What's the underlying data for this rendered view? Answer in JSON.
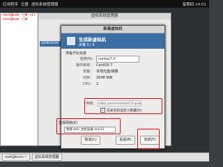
{
  "topbar": {
    "apps": "应用程序",
    "places": "位置",
    "app": "虚拟系统管理器",
    "time": "星期四 14:01"
  },
  "terminal": {
    "lines": [
      "root@kvm ~]# vir",
      "root@kvm ~]#"
    ]
  },
  "vmm": {
    "title": "虚拟系统管理器",
    "list_item": "QEMU/KVM"
  },
  "dialog": {
    "title": "新建虚拟机",
    "header_title": "生成新虚拟机",
    "header_sub": "步骤 5 / 5",
    "section": "准备开始安装",
    "name_label": "名称(N):",
    "name_value": "centos7.0",
    "os_label": "操作系统：",
    "os_value": "CentOS 7",
    "install_label": "安装：",
    "install_value": "本地光盘/镜像",
    "mem_label": "内存：",
    "mem_value": "2048 MiB",
    "cpu_label": "CPU：",
    "cpu_value": "2",
    "storage_label": "存储：",
    "storage_path": "/data_kvm/vm/centos7.0.qcow2",
    "custom_label": "在安装前自定义配置(U)",
    "custom_checked": "✔",
    "net_label": "选择网络(E)",
    "net_value": "桥接 br0: 主机设备 ens33",
    "cancel": "取消(C)",
    "back": "后退(B)",
    "finish": "完成(F)"
  },
  "taskbar": {
    "task1": "root@kvm:~",
    "task2": "虚拟系统管理器"
  }
}
